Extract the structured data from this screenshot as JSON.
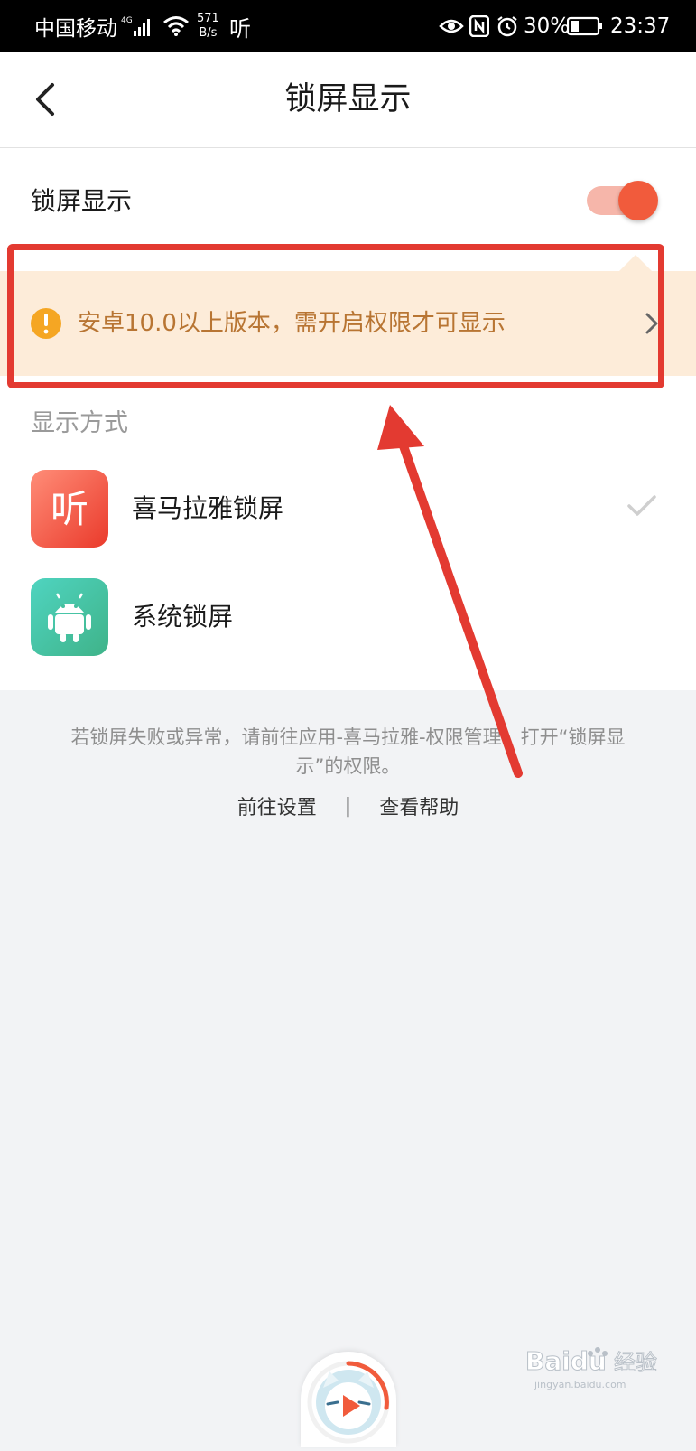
{
  "status_bar": {
    "carrier": "中国移动",
    "network": "4G",
    "speed_value": "571",
    "speed_unit": "B/s",
    "app_indicator": "听",
    "battery": "30%",
    "time": "23:37"
  },
  "header": {
    "title": "锁屏显示",
    "back_icon": "chevron-left-icon"
  },
  "lock_screen": {
    "label": "锁屏显示",
    "enabled": true,
    "accent_color": "#f15b3c"
  },
  "notice": {
    "text": "安卓10.0以上版本，需开启权限才可显示",
    "icon": "warning-icon",
    "color": "#b87533",
    "background": "#fdecd9"
  },
  "display_mode": {
    "label": "显示方式",
    "options": [
      {
        "label": "喜马拉雅锁屏",
        "icon": "ximalaya-app-icon",
        "selected": true
      },
      {
        "label": "系统锁屏",
        "icon": "android-icon",
        "selected": false
      }
    ]
  },
  "footer": {
    "hint": "若锁屏失败或异常，请前往应用-喜马拉雅-权限管理，打开“锁屏显示”的权限。",
    "link_settings": "前往设置",
    "separator": "|",
    "link_help": "查看帮助"
  },
  "annotation_color": "#e33a31",
  "watermark": {
    "brand": "Baidu",
    "suffix": "经验",
    "domain": "jingyan.baidu.com"
  }
}
